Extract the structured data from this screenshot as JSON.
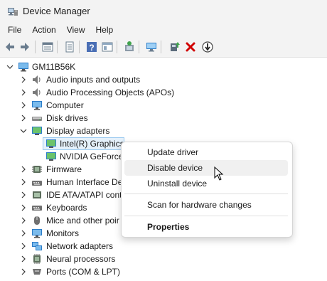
{
  "window": {
    "title": "Device Manager"
  },
  "menu": [
    "File",
    "Action",
    "View",
    "Help"
  ],
  "toolbar": {
    "icons": [
      "back-arrow-icon",
      "forward-arrow-icon",
      "properties-icon",
      "print-icon",
      "help-icon",
      "view-icon",
      "scan-hardware-icon",
      "monitor-icon",
      "update-driver-icon",
      "uninstall-x-icon",
      "disable-down-icon"
    ],
    "uninstall_color": "#d10000"
  },
  "tree": {
    "root": "GM11B56K",
    "nodes": [
      "Audio inputs and outputs",
      "Audio Processing Objects (APOs)",
      "Computer",
      "Disk drives",
      "Display adapters",
      "Intel(R) Graphics",
      "NVIDIA GeForce",
      "Firmware",
      "Human Interface De",
      "IDE ATA/ATAPI cont",
      "Keyboards",
      "Mice and other poir",
      "Monitors",
      "Network adapters",
      "Neural processors",
      "Ports (COM & LPT)"
    ]
  },
  "context_menu": {
    "items": [
      "Update driver",
      "Disable device",
      "Uninstall device",
      "Scan for hardware changes",
      "Properties"
    ]
  },
  "colors": {
    "selection_bg": "#e5f1fb",
    "selection_border": "#99c9ef",
    "accent": "#0078d4"
  }
}
